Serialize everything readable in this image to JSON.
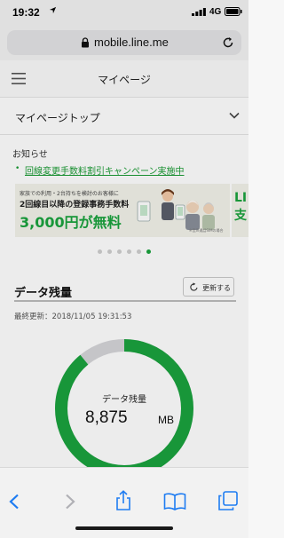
{
  "status_bar": {
    "time": "19:32",
    "network": "4G"
  },
  "browser": {
    "url": "mobile.line.me"
  },
  "app_bar": {
    "title": "マイページ"
  },
  "top_menu": {
    "label": "マイページトップ"
  },
  "notices": {
    "title": "お知らせ",
    "bullet": "•",
    "items": [
      {
        "text": "回線変更手数料割引キャンペーン実施中"
      }
    ]
  },
  "banner": {
    "line1": "家族での利用・2台持ちを検討のお客様に",
    "line2": "2回線目以降の登録事務手数料",
    "price": "3,000円が無料",
    "note": "※音声通話SIMの場合",
    "next_peek": "LI支"
  },
  "carousel": {
    "total": 6,
    "active_index": 5
  },
  "data_usage": {
    "title": "データ残量",
    "refresh_label": "更新する",
    "last_updated": "最終更新：2018/11/05 19:31:53",
    "gauge_label": "データ残量",
    "remaining": "8,875",
    "unit": "MB",
    "remaining_fraction": 0.89
  },
  "colors": {
    "accent": "#1aa33e",
    "gauge_track": "#d5d5d9",
    "link": "#1a9b34",
    "ios_blue": "#1e7cf2"
  }
}
